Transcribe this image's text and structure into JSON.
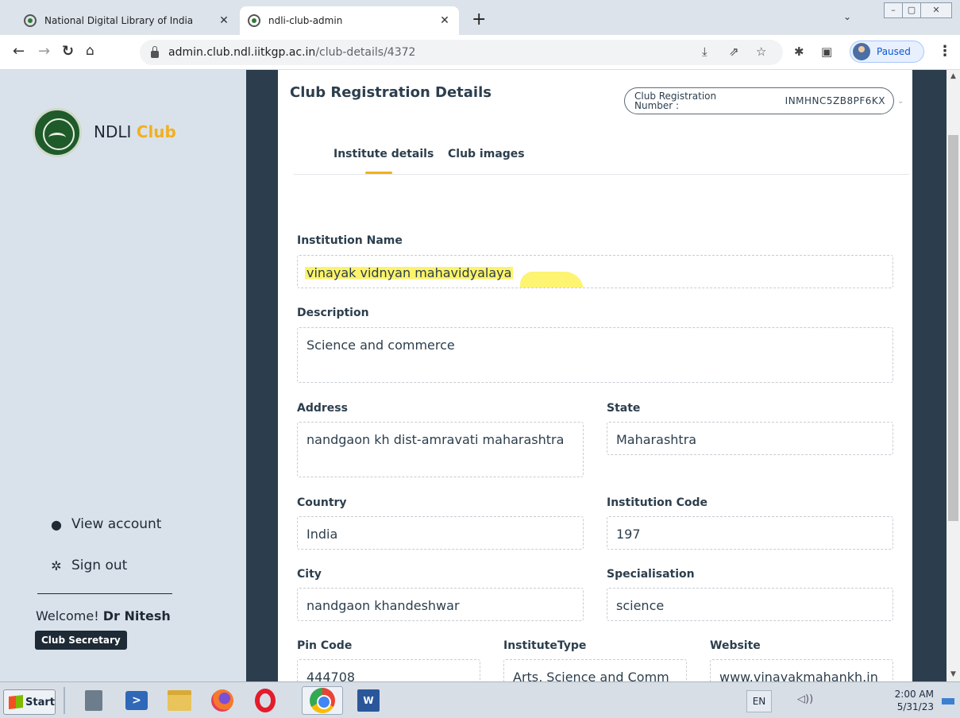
{
  "browser": {
    "tabs": [
      {
        "title": "National Digital Library of India",
        "active": false
      },
      {
        "title": "ndli-club-admin",
        "active": true
      }
    ],
    "new_tab": "+",
    "tab_search_icon": "chevron-down-icon",
    "window_controls": [
      "–",
      "▢",
      "✕"
    ],
    "url_host": "admin.club.ndl.iitkgp.ac.in",
    "url_path": "/club-details/4372",
    "profile_status": "Paused"
  },
  "sidebar": {
    "brand_prefix": "NDLI",
    "brand_suffix": "Club",
    "links": [
      {
        "label": "View account",
        "icon": "user-icon"
      },
      {
        "label": "Sign out",
        "icon": "gear-icon"
      }
    ],
    "welcome_prefix": "Welcome!",
    "user_name": "Dr Nitesh",
    "role": "Club Secretary"
  },
  "main": {
    "title": "Club Registration Details",
    "reg_label": "Club Registration Number :",
    "reg_value": "INMHNC5ZB8PF6KX",
    "tabs": [
      {
        "label": "Institute details",
        "active": true
      },
      {
        "label": "Club images",
        "active": false
      }
    ],
    "fields": {
      "institution_name": {
        "label": "Institution Name",
        "value": "vinayak vidnyan mahavidyalaya"
      },
      "description": {
        "label": "Description",
        "value": "Science and commerce"
      },
      "address": {
        "label": "Address",
        "value": "nandgaon kh dist-amravati maharashtra"
      },
      "state": {
        "label": "State",
        "value": "Maharashtra"
      },
      "country": {
        "label": "Country",
        "value": "India"
      },
      "institution_code": {
        "label": "Institution Code",
        "value": "197"
      },
      "city": {
        "label": "City",
        "value": "nandgaon khandeshwar"
      },
      "specialisation": {
        "label": "Specialisation",
        "value": "science"
      },
      "pin_code": {
        "label": "Pin Code",
        "value": "444708"
      },
      "institute_type": {
        "label": "InstituteType",
        "value": "Arts, Science and Comm"
      },
      "website": {
        "label": "Website",
        "value": "www.vinayakmahankh.in"
      }
    },
    "highlight_color": "#fdf36a"
  },
  "taskbar": {
    "start_label": "Start",
    "apps": [
      "server-manager-icon",
      "powershell-icon",
      "folder-icon",
      "firefox-icon",
      "opera-icon",
      "chrome-icon",
      "word-icon"
    ],
    "language": "EN",
    "time": "2:00 AM",
    "date": "5/31/23"
  },
  "colors": {
    "accent_yellow": "#f2b01e",
    "sidebar_bg": "#d9e2eb",
    "dark_band": "#2c3e4d"
  }
}
